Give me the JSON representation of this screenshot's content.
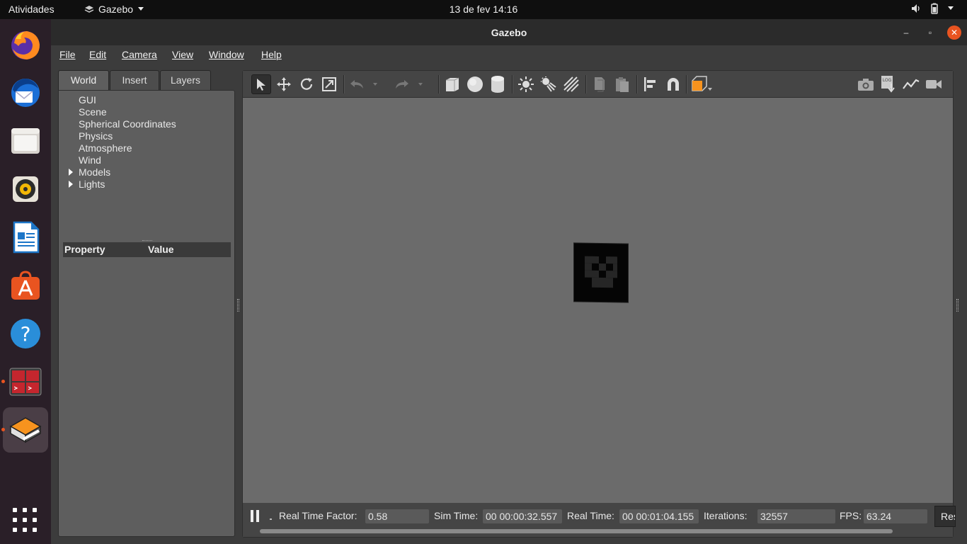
{
  "topbar": {
    "activities": "Atividades",
    "app_name": "Gazebo",
    "clock": "13 de fev  14:16"
  },
  "dock": {
    "items": [
      {
        "name": "Firefox",
        "icon": "firefox-icon"
      },
      {
        "name": "Thunderbird",
        "icon": "thunderbird-icon"
      },
      {
        "name": "Files",
        "icon": "files-icon"
      },
      {
        "name": "Rhythmbox",
        "icon": "rhythmbox-icon"
      },
      {
        "name": "LibreOffice Writer",
        "icon": "writer-icon"
      },
      {
        "name": "Ubuntu Software",
        "icon": "software-store-icon"
      },
      {
        "name": "Help",
        "icon": "help-icon",
        "glyph": "?"
      },
      {
        "name": "Terminal",
        "icon": "terminal-icon"
      },
      {
        "name": "Gazebo",
        "icon": "gazebo-icon"
      }
    ]
  },
  "window": {
    "title": "Gazebo",
    "controls": {
      "minimize": "–",
      "maximize": "▫",
      "close": "✕"
    }
  },
  "menubar": {
    "items": [
      "File",
      "Edit",
      "Camera",
      "View",
      "Window",
      "Help"
    ]
  },
  "left_panel": {
    "tabs": [
      "World",
      "Insert",
      "Layers"
    ],
    "selected_tab": "World",
    "tree": [
      {
        "label": "GUI",
        "expandable": false
      },
      {
        "label": "Scene",
        "expandable": false
      },
      {
        "label": "Spherical Coordinates",
        "expandable": false
      },
      {
        "label": "Physics",
        "expandable": false
      },
      {
        "label": "Atmosphere",
        "expandable": false
      },
      {
        "label": "Wind",
        "expandable": false
      },
      {
        "label": "Models",
        "expandable": true
      },
      {
        "label": "Lights",
        "expandable": true
      }
    ],
    "property_header": {
      "property": "Property",
      "value": "Value"
    }
  },
  "toolbar": {
    "tools": [
      "select-mode-icon",
      "translate-mode-icon",
      "rotate-mode-icon",
      "scale-mode-icon",
      "undo-icon",
      "redo-icon",
      "box-shape-icon",
      "sphere-shape-icon",
      "cylinder-shape-icon",
      "point-light-icon",
      "spot-light-icon",
      "directional-light-icon",
      "copy-icon",
      "paste-icon",
      "align-icon",
      "snap-icon",
      "view-angle-icon"
    ],
    "right_tools": [
      "screenshot-icon",
      "log-icon",
      "plot-icon",
      "record-video-icon"
    ],
    "log_text": "LOG"
  },
  "status": {
    "real_time_factor_label": "Real Time Factor:",
    "real_time_factor": "0.58",
    "sim_time_label": "Sim Time:",
    "sim_time": "00 00:00:32.557",
    "real_time_label": "Real Time:",
    "real_time": "00 00:01:04.155",
    "iterations_label": "Iterations:",
    "iterations": "32557",
    "fps_label": "FPS:",
    "fps": "63.24",
    "reset_label": "Reset"
  },
  "colors": {
    "accent": "#e95420",
    "scene_bg": "#6b6b6b",
    "panel_bg": "#5e5e5e",
    "toolbar_bg": "#454545"
  }
}
